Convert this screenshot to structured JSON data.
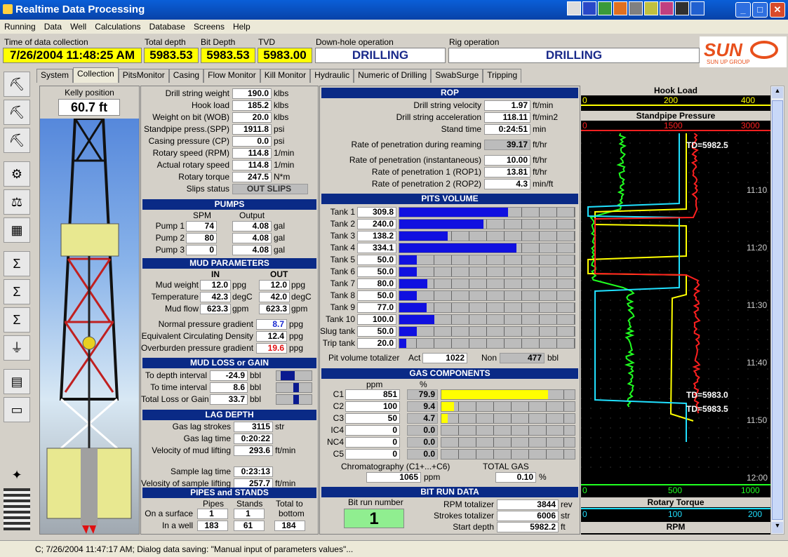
{
  "window": {
    "title": "Realtime Data Processing"
  },
  "menu": [
    "Running",
    "Data",
    "Well",
    "Calculations",
    "Database",
    "Screens",
    "Help"
  ],
  "header": {
    "time_label": "Time of data collection",
    "time_value": "7/26/2004 11:48:25 AM",
    "total_depth_label": "Total depth",
    "total_depth_value": "5983.53",
    "bit_depth_label": "Bit Depth",
    "bit_depth_value": "5983.53",
    "tvd_label": "TVD",
    "tvd_value": "5983.00",
    "downhole_label": "Down-hole operation",
    "downhole_value": "DRILLING",
    "rig_label": "Rig operation",
    "rig_value": "DRILLING",
    "logo_text": "SUN",
    "logo_sub": "SUN UP GROUP"
  },
  "tabs": [
    "System",
    "Collection",
    "PitsMonitor",
    "Casing",
    "Flow Monitor",
    "Kill Monitor",
    "Hydraulic",
    "Numeric of Drilling",
    "SwabSurge",
    "Tripping"
  ],
  "kelly": {
    "label": "Kelly position",
    "value": "60.7 ft"
  },
  "drilling": [
    {
      "label": "Drill string weight",
      "value": "190.0",
      "unit": "klbs"
    },
    {
      "label": "Hook load",
      "value": "185.2",
      "unit": "klbs"
    },
    {
      "label": "Weight on bit (WOB)",
      "value": "20.0",
      "unit": "klbs"
    },
    {
      "label": "Standpipe press.(SPP)",
      "value": "1911.8",
      "unit": "psi"
    },
    {
      "label": "Casing pressure (CP)",
      "value": "0.0",
      "unit": "psi"
    },
    {
      "label": "Rotary speed (RPM)",
      "value": "114.8",
      "unit": "1/min"
    },
    {
      "label": "Actual rotary speed",
      "value": "114.8",
      "unit": "1/min"
    },
    {
      "label": "Rotary torque",
      "value": "247.5",
      "unit": "N*m"
    }
  ],
  "slips": {
    "label": "Slips status",
    "value": "OUT SLIPS"
  },
  "pumps": {
    "title": "PUMPS",
    "spm_label": "SPM",
    "output_label": "Output",
    "rows": [
      {
        "name": "Pump 1",
        "spm": "74",
        "out": "4.08",
        "unit": "gal"
      },
      {
        "name": "Pump 2",
        "spm": "80",
        "out": "4.08",
        "unit": "gal"
      },
      {
        "name": "Pump 3",
        "spm": "0",
        "out": "4.08",
        "unit": "gal"
      }
    ]
  },
  "mud": {
    "title": "MUD PARAMETERS",
    "in_label": "IN",
    "out_label": "OUT",
    "rows": [
      {
        "label": "Mud weight",
        "in": "12.0",
        "out": "12.0",
        "unit": "ppg"
      },
      {
        "label": "Temperature",
        "in": "42.3",
        "out": "42.0",
        "unit": "degC"
      },
      {
        "label": "Mud flow",
        "in": "623.3",
        "out": "623.3",
        "unit": "gpm"
      }
    ],
    "extra": [
      {
        "label": "Normal pressure gradient",
        "value": "8.7",
        "unit": "ppg",
        "color": "#1a2ad0"
      },
      {
        "label": "Equivalent Circulating Density",
        "value": "12.4",
        "unit": "ppg",
        "color": "#000000"
      },
      {
        "label": "Overburden pressure gradient",
        "value": "19.6",
        "unit": "ppg",
        "color": "#e01010"
      }
    ]
  },
  "mudloss": {
    "title": "MUD LOSS or GAIN",
    "rows": [
      {
        "label": "To depth interval",
        "value": "-24.9",
        "unit": "bbl"
      },
      {
        "label": "To time interval",
        "value": "8.6",
        "unit": "bbl"
      },
      {
        "label": "Total Loss or Gain",
        "value": "33.7",
        "unit": "bbl"
      }
    ]
  },
  "lag": {
    "title": "LAG DEPTH",
    "rows": [
      {
        "label": "Gas lag strokes",
        "value": "3115",
        "unit": "str"
      },
      {
        "label": "Gas lag time",
        "value": "0:20:22",
        "unit": ""
      },
      {
        "label": "Velocity of mud lifting",
        "value": "293.6",
        "unit": "ft/min"
      },
      {
        "label": "Sample lag time",
        "value": "0:23:13",
        "unit": ""
      },
      {
        "label": "Velosity of sample lifting",
        "value": "257.7",
        "unit": "ft/min"
      }
    ]
  },
  "pipes": {
    "title": "PIPES and STANDS",
    "pipes_label": "Pipes",
    "stands_label": "Stands",
    "total_label": "Total to",
    "bottom_label": "bottom",
    "surface_label": "On a surface",
    "surface_pipes": "1",
    "surface_stands": "1",
    "well_label": "In a well",
    "well_pipes": "183",
    "well_stands": "61",
    "well_total": "184"
  },
  "rop": {
    "title": "ROP",
    "rows": [
      {
        "label": "Drill string velocity",
        "value": "1.97",
        "unit": "ft/min"
      },
      {
        "label": "Drill string acceleration",
        "value": "118.11",
        "unit": "ft/min2"
      },
      {
        "label": "Stand time",
        "value": "0:24:51",
        "unit": "min"
      }
    ],
    "reaming": {
      "label": "Rate of penetration during reaming",
      "value": "39.17",
      "unit": "ft/hr"
    },
    "rows2": [
      {
        "label": "Rate of penetration (instantaneous)",
        "value": "10.00",
        "unit": "ft/hr"
      },
      {
        "label": "Rate of penetration 1 (ROP1)",
        "value": "13.81",
        "unit": "ft/hr"
      },
      {
        "label": "Rate of penetration 2 (ROP2)",
        "value": "4.3",
        "unit": "min/ft"
      }
    ]
  },
  "pits": {
    "title": "PITS VOLUME",
    "max": 500,
    "tanks": [
      {
        "name": "Tank 1",
        "value": "309.8"
      },
      {
        "name": "Tank 2",
        "value": "240.0"
      },
      {
        "name": "Tank 3",
        "value": "138.2"
      },
      {
        "name": "Tank 4",
        "value": "334.1"
      },
      {
        "name": "Tank 5",
        "value": "50.0"
      },
      {
        "name": "Tank 6",
        "value": "50.0"
      },
      {
        "name": "Tank 7",
        "value": "80.0"
      },
      {
        "name": "Tank 8",
        "value": "50.0"
      },
      {
        "name": "Tank 9",
        "value": "77.0"
      },
      {
        "name": "Tank 10",
        "value": "100.0"
      },
      {
        "name": "Slug tank",
        "value": "50.0"
      },
      {
        "name": "Trip tank",
        "value": "20.0"
      }
    ],
    "tot_label": "Pit volume totalizer",
    "act_label": "Act",
    "act_value": "1022",
    "non_label": "Non",
    "non_value": "477",
    "unit": "bbl"
  },
  "gas": {
    "title": "GAS COMPONENTS",
    "ppm_label": "ppm",
    "pct_label": "%",
    "rows": [
      {
        "name": "C1",
        "ppm": "851",
        "pct": "79.9"
      },
      {
        "name": "C2",
        "ppm": "100",
        "pct": "9.4"
      },
      {
        "name": "C3",
        "ppm": "50",
        "pct": "4.7"
      },
      {
        "name": "IC4",
        "ppm": "0",
        "pct": "0.0"
      },
      {
        "name": "NC4",
        "ppm": "0",
        "pct": "0.0"
      },
      {
        "name": "C5",
        "ppm": "0",
        "pct": "0.0"
      }
    ],
    "chrom_label": "Chromatography (C1+...+C6)",
    "chrom_value": "1065",
    "chrom_unit": "ppm",
    "total_label": "TOTAL GAS",
    "total_value": "0.10",
    "total_unit": "%"
  },
  "bitrun": {
    "title": "BIT RUN DATA",
    "num_label": "Bit run number",
    "num_value": "1",
    "rows": [
      {
        "label": "RPM totalizer",
        "value": "3844",
        "unit": "rev"
      },
      {
        "label": "Strokes totalizer",
        "value": "6006",
        "unit": "str"
      },
      {
        "label": "Start depth",
        "value": "5982.2",
        "unit": "ft"
      }
    ]
  },
  "chart": {
    "hook_title": "Hook Load",
    "hook_ticks": [
      "0",
      "200",
      "400"
    ],
    "spp_title": "Standpipe Pressure",
    "spp_ticks": [
      "0",
      "1500",
      "3000"
    ],
    "times": [
      "11:10",
      "11:20",
      "11:30",
      "11:40",
      "11:50",
      "12:00"
    ],
    "td_labels": [
      "TD=5982.5",
      "TD=5983.0",
      "TD=5983.5"
    ],
    "bottom_ticks": [
      "0",
      "500",
      "1000"
    ],
    "torque_title": "Rotary Torque",
    "torque_ticks": [
      "0",
      "100",
      "200"
    ],
    "rpm_title": "RPM"
  },
  "status": "C; 7/26/2004 11:47:17 AM;  Dialog data saving: \"Manual input of parameters values\"..."
}
